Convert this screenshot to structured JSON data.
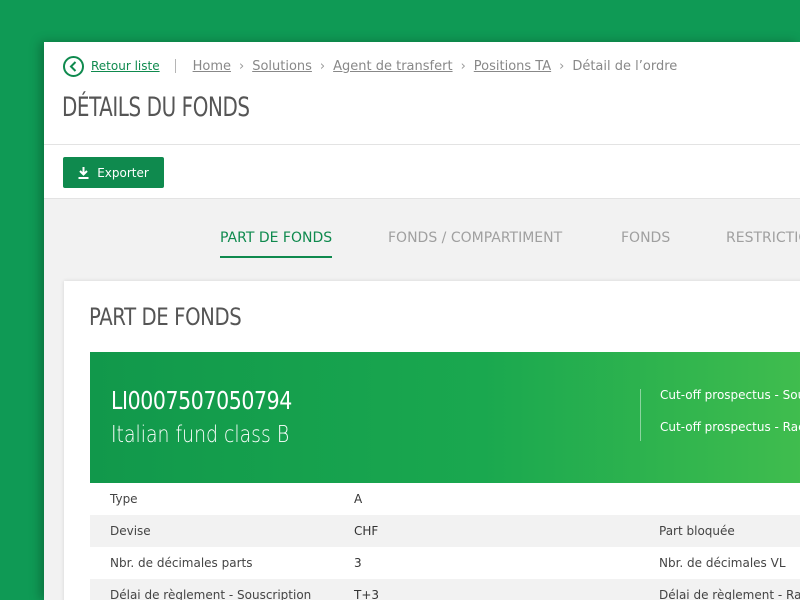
{
  "breadcrumb": {
    "back_label": "Retour liste",
    "items": [
      "Home",
      "Solutions",
      "Agent de transfert",
      "Positions TA"
    ],
    "current": "Détail de l’ordre"
  },
  "page_title": "DÉTAILS DU FONDS",
  "toolbar": {
    "export_label": "Exporter"
  },
  "tabs": [
    "PART DE FONDS",
    "FONDS / COMPARTIMENT",
    "FONDS",
    "RESTRICTIO"
  ],
  "active_tab": "PART DE FONDS",
  "card": {
    "title": "PART DE FONDS",
    "isin": "LI0007507050794",
    "fund_name": "Italian fund class B",
    "cutoff": [
      "Cut-off prospectus - Sousc",
      "Cut-off prospectus - Rach"
    ]
  },
  "rows": [
    {
      "label": "Type",
      "value": "A",
      "label2": ""
    },
    {
      "label": "Devise",
      "value": "CHF",
      "label2": "Part bloquée"
    },
    {
      "label": "Nbr. de décimales parts",
      "value": "3",
      "label2": "Nbr. de décimales VL"
    },
    {
      "label": "Délai de règlement - Souscription",
      "value": "T+3",
      "label2": "Délai de règlement - Rach"
    }
  ],
  "colors": {
    "background": "#0f9a55",
    "accent": "#0f8a4e"
  }
}
